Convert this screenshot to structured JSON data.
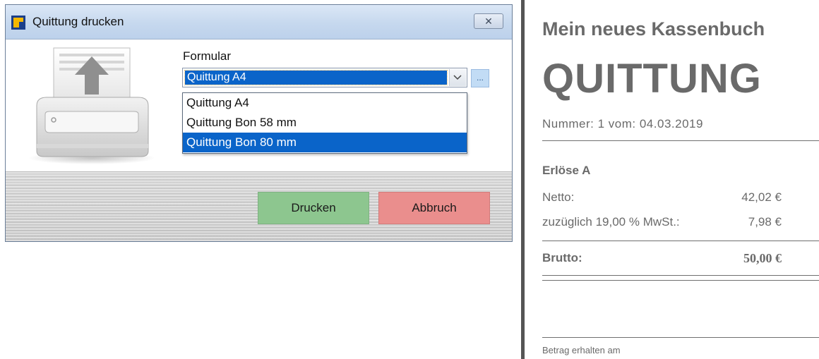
{
  "dialog": {
    "title": "Quittung drucken",
    "close_symbol": "✕",
    "form_label": "Formular",
    "selected_form": "Quittung A4",
    "more_button": "...",
    "options": [
      "Quittung A4",
      "Quittung Bon 58 mm",
      "Quittung Bon 80 mm"
    ],
    "highlighted_option_index": 2,
    "buttons": {
      "print": "Drucken",
      "cancel": "Abbruch"
    },
    "colors": {
      "print_button": "#8dc68f",
      "cancel_button": "#ea8e8d",
      "selection": "#0a64c9"
    }
  },
  "receipt": {
    "company": "Mein neues Kassenbuch",
    "title": "QUITTUNG",
    "number_line": "Nummer: 1 vom: 04.03.2019",
    "section": "Erlöse A",
    "net_label": "Netto:",
    "net_value": "42,02 €",
    "tax_label": "zuzüglich 19,00 % MwSt.:",
    "tax_value": "7,98 €",
    "gross_label": "Brutto:",
    "gross_value": "50,00 €",
    "received_label": "Betrag erhalten am"
  }
}
